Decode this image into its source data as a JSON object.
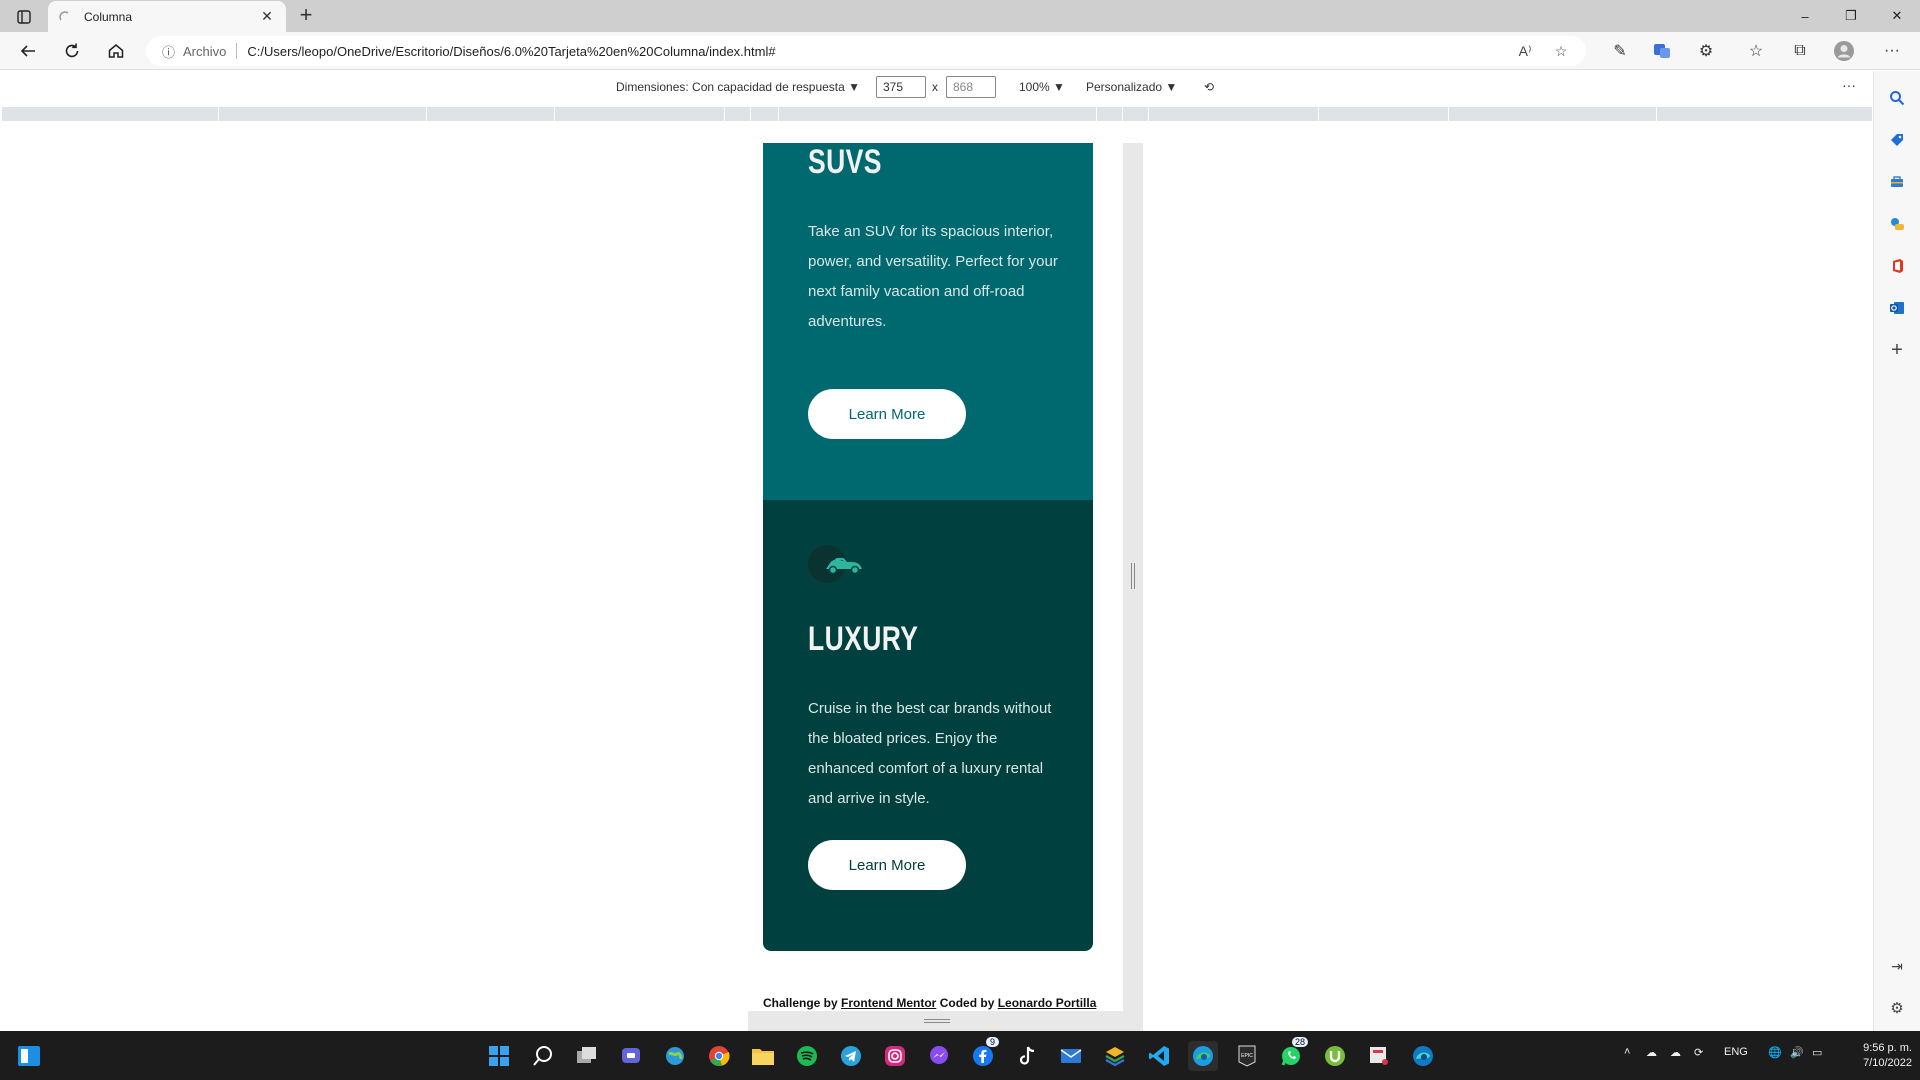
{
  "browser": {
    "tab_title": "Columna",
    "new_tab_glyph": "+",
    "close_glyph": "✕",
    "address_label": "Archivo",
    "url": "C:/Users/leopo/OneDrive/Escritorio/Diseños/6.0%20Tarjeta%20en%20Columna/index.html#",
    "window_controls": [
      "–",
      "❐",
      "✕"
    ]
  },
  "device_toolbar": {
    "dimensions_label": "Dimensiones: Con capacidad de respuesta ▼",
    "width_value": "375",
    "times": "x",
    "height_value": "868",
    "zoom": "100% ▼",
    "throttle": "Personalizado ▼",
    "more": "···"
  },
  "page": {
    "cards": [
      {
        "title": "SUVS",
        "text": "Take an SUV for its spacious interior, power, and versatility. Perfect for your next family vacation and off-road adventures.",
        "button": "Learn More",
        "color": "#006970"
      },
      {
        "title": "LUXURY",
        "text": "Cruise in the best car brands without the bloated prices. Enjoy the enhanced comfort of a luxury rental and arrive in style.",
        "button": "Learn More",
        "color": "#00403f"
      }
    ],
    "footer": {
      "prefix": "Challenge by",
      "link1": "Frontend Mentor",
      "middle": "Coded by",
      "link2": "Leonardo Portilla"
    }
  },
  "sidebar": {
    "icons": [
      "search-icon",
      "tag-icon",
      "toolbox-icon",
      "games-icon",
      "office-icon",
      "outlook-icon",
      "add-icon"
    ]
  },
  "taskbar": {
    "tray_lang": "ENG",
    "time": "9:56 p. m.",
    "date": "7/10/2022",
    "badges": {
      "messenger": "9",
      "whatsapp": "28"
    }
  }
}
